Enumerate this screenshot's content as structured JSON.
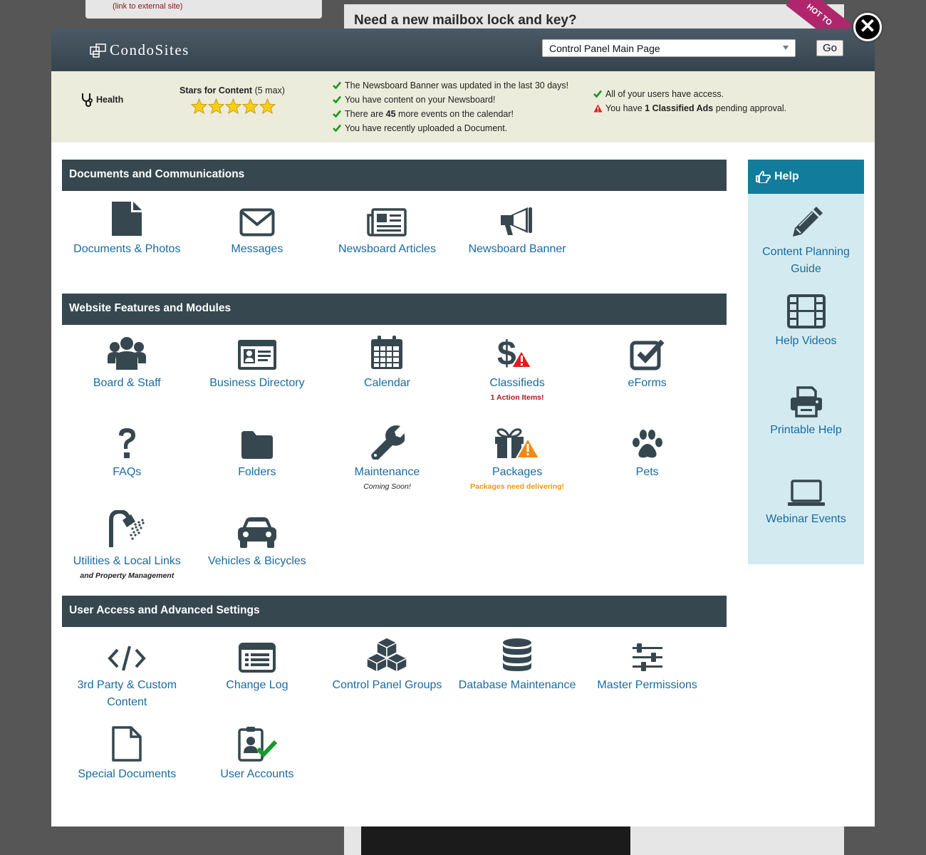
{
  "background": {
    "external_link": "(link to external site)",
    "headline": "Need a new mailbox lock and key?",
    "ribbon": "HOT TO"
  },
  "header": {
    "brand": "CondoSites",
    "page_select": "Control Panel Main Page",
    "go_label": "Go",
    "close_glyph": "✕"
  },
  "health": {
    "label": "Health",
    "stars_title": "Stars for Content",
    "stars_max": "(5 max)",
    "stars": 5,
    "checks_left": [
      {
        "status": "ok",
        "text": "The Newsboard Banner was updated in the last 30 days!"
      },
      {
        "status": "ok",
        "text": "You have content on your Newsboard!"
      },
      {
        "status": "ok",
        "text": "There are 45 more events on the calendar!"
      },
      {
        "status": "ok",
        "text": "You have recently uploaded a Document."
      }
    ],
    "checks_right": [
      {
        "status": "ok",
        "text": "All of your users have access."
      },
      {
        "status": "warn",
        "text": "You have 1 Classified Ads pending approval."
      }
    ]
  },
  "sections": [
    {
      "title": "Documents and Communications",
      "items": [
        {
          "label": "Documents & Photos",
          "icon": "document-icon"
        },
        {
          "label": "Messages",
          "icon": "envelope-icon"
        },
        {
          "label": "Newsboard Articles",
          "icon": "newspaper-icon"
        },
        {
          "label": "Newsboard Banner",
          "icon": "megaphone-icon"
        }
      ]
    },
    {
      "title": "Website Features and Modules",
      "items": [
        {
          "label": "Board & Staff",
          "icon": "group-icon"
        },
        {
          "label": "Business Directory",
          "icon": "id-card-icon"
        },
        {
          "label": "Calendar",
          "icon": "calendar-icon"
        },
        {
          "label": "Classifieds",
          "icon": "dollar-warning-icon",
          "note": "1 Action Items!",
          "note_style": "alert-red"
        },
        {
          "label": "eForms",
          "icon": "checkbox-icon"
        },
        {
          "label": "FAQs",
          "icon": "question-icon"
        },
        {
          "label": "Folders",
          "icon": "folder-icon"
        },
        {
          "label": "Maintenance",
          "icon": "wrench-icon",
          "note": "Coming Soon!",
          "note_style": "sub plain"
        },
        {
          "label": "Packages",
          "icon": "gift-warning-icon",
          "note": "Packages need delivering!",
          "note_style": "alert-orange"
        },
        {
          "label": "Pets",
          "icon": "paw-icon"
        },
        {
          "label": "Utilities & Local Links",
          "icon": "shower-icon",
          "note": "and Property Management",
          "note_style": "sub"
        },
        {
          "label": "Vehicles & Bicycles",
          "icon": "car-icon"
        }
      ]
    },
    {
      "title": "User Access and Advanced Settings",
      "items": [
        {
          "label": "3rd Party & Custom Content",
          "icon": "code-icon"
        },
        {
          "label": "Change Log",
          "icon": "list-icon"
        },
        {
          "label": "Control Panel Groups",
          "icon": "cubes-icon"
        },
        {
          "label": "Database Maintenance",
          "icon": "database-icon"
        },
        {
          "label": "Master Permissions",
          "icon": "sliders-icon"
        },
        {
          "label": "Special Documents",
          "icon": "blank-document-icon"
        },
        {
          "label": "User Accounts",
          "icon": "user-badge-check-icon"
        }
      ]
    }
  ],
  "help": {
    "title": "Help",
    "items": [
      {
        "label": "Content Planning Guide",
        "icon": "pencil-icon"
      },
      {
        "label": "Help Videos",
        "icon": "film-icon"
      },
      {
        "label": "Printable Help",
        "icon": "printer-icon"
      },
      {
        "label": "Webinar Events",
        "icon": "laptop-icon"
      }
    ]
  },
  "colors": {
    "section_header": "#36474f",
    "link": "#1a6aa0",
    "help_header": "#127c9c",
    "help_panel": "#d3ebf0",
    "health_bar": "#ececdc",
    "icon": "#36474f"
  }
}
